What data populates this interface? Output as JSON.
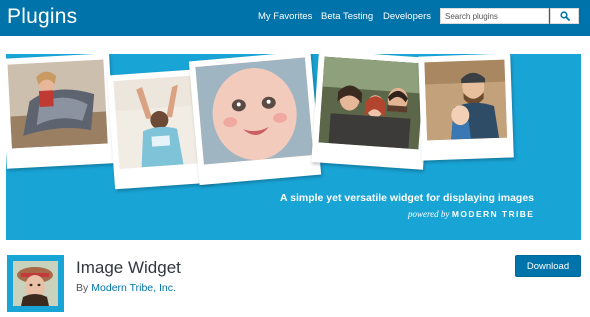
{
  "header": {
    "title": "Plugins",
    "nav": [
      "My Favorites",
      "Beta Testing",
      "Developers"
    ],
    "search": {
      "placeholder": "Search plugins"
    }
  },
  "banner": {
    "tagline": "A simple yet versatile widget for displaying images",
    "powered_by": "powered by",
    "brand": "MODERN TRIBE",
    "background_color": "#19a4d6"
  },
  "plugin": {
    "name": "Image Widget",
    "by_label": "By",
    "author": "Modern Tribe, Inc.",
    "download_label": "Download"
  },
  "colors": {
    "accent": "#0073aa",
    "banner": "#19a4d6"
  }
}
